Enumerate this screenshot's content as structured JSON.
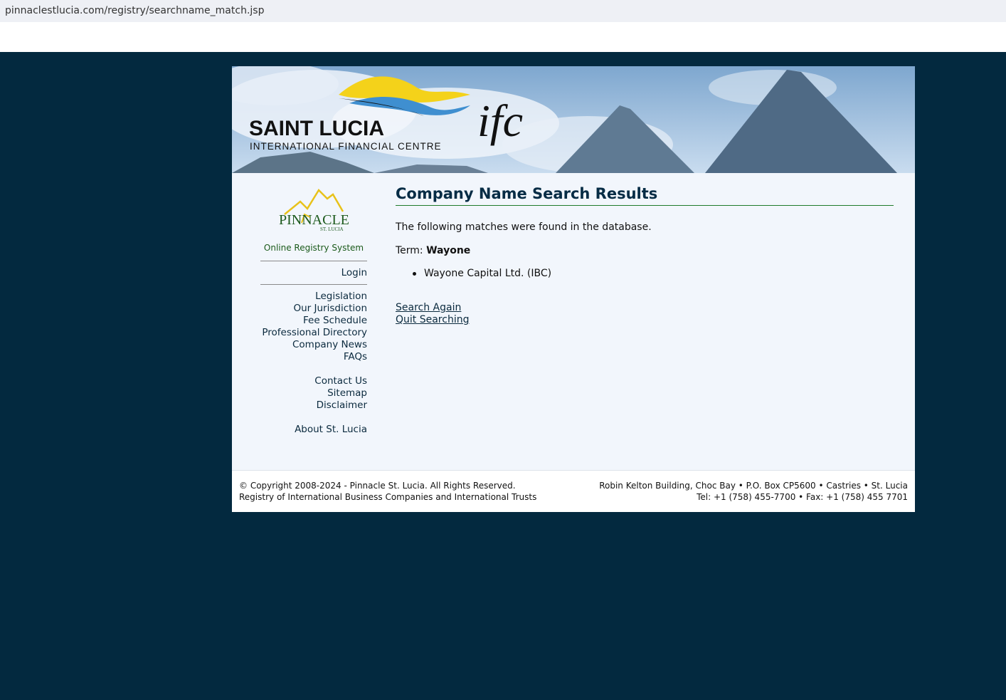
{
  "browser": {
    "url": "pinnaclestlucia.com/registry/searchname_match.jsp"
  },
  "banner": {
    "brand_main": "SAINT LUCIA",
    "brand_sub": "INTERNATIONAL FINANCIAL CENTRE",
    "brand_ifc": "ifc"
  },
  "sidebar": {
    "logo_text": "PINNACLE",
    "logo_sub": "ST. LUCIA",
    "system_label": "Online Registry System",
    "login": "Login",
    "links_group1": [
      "Legislation",
      "Our Jurisdiction",
      "Fee Schedule",
      "Professional Directory",
      "Company News",
      "FAQs"
    ],
    "links_group2": [
      "Contact Us",
      "Sitemap",
      "Disclaimer"
    ],
    "links_group3": [
      "About St. Lucia"
    ]
  },
  "main": {
    "title": "Company Name Search Results",
    "intro": "The following matches were found in the database.",
    "term_label": "Term:",
    "term_value": "Wayone",
    "results": [
      "Wayone Capital Ltd. (IBC)"
    ],
    "search_again": "Search Again",
    "quit_searching": "Quit Searching"
  },
  "footer": {
    "copyright": "© Copyright 2008-2024 - Pinnacle St. Lucia. All Rights Reserved.",
    "registry": "Registry of International Business Companies and International Trusts",
    "address": "Robin Kelton Building, Choc Bay • P.O. Box CP5600 • Castries • St. Lucia",
    "phone": "Tel: +1 (758) 455-7700 • Fax: +1 (758) 455 7701"
  },
  "colors": {
    "background": "#03293f",
    "title": "#062c45",
    "rule": "#1f7a2a"
  }
}
